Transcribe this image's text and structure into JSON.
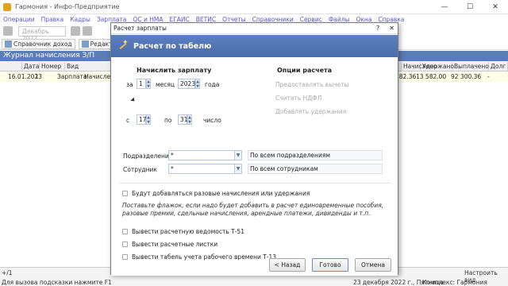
{
  "window": {
    "title": "Гармония - Инфо-Предприятие"
  },
  "menu": [
    "Операции",
    "Правка",
    "Кадры",
    "Зарплата",
    "ОС и НМА",
    "ЕГАИС",
    "ВЕТИС",
    "Отчеты",
    "Справочники",
    "Сервис",
    "Файлы",
    "Окна",
    "Справка"
  ],
  "toolbar": {
    "period": "Декабрь 2022",
    "btn_directory": "Справочник доход",
    "btn_edit": "Редактиров"
  },
  "journal": {
    "title": "Журнал начисления З/П",
    "columns": [
      "Дата",
      "Номер",
      "Вид",
      "",
      "Начислено",
      "Удержано",
      "Выплачено",
      "Долг"
    ],
    "row": {
      "date": "16.01.2023",
      "number": "1",
      "kind": "Зарплата",
      "kind2": "Начисле",
      "accrued": "582.36",
      "withheld": "13 582.00",
      "paid": "92 300.36",
      "debt": "-"
    },
    "footer_count": "+/1"
  },
  "status": {
    "hint": "Для вызова подсказки нажмите F1",
    "date": "23 декабря 2022 г., Пятница",
    "company": "Комплекс: Гармония",
    "settings": "Настроить вид"
  },
  "dialog": {
    "window_title": "Расчет зарплаты",
    "help": "?",
    "close": "✕",
    "header": "Расчет по табелю",
    "section_calc": "Начислить зарплату",
    "section_options": "Опции расчета",
    "label_for": "за",
    "day_value": "1",
    "label_month": "месяц",
    "year_value": "2023",
    "label_year": "года",
    "label_from": "с",
    "from_value": "17",
    "label_to": "по",
    "to_value": "31",
    "label_day": "число",
    "opt_deductions": "Предоставлять вычеты",
    "opt_ndfl": "Считать НДФЛ",
    "opt_withholding": "Добавлять удержания",
    "label_department": "Подразделение",
    "department_value": "*",
    "department_info": "По всем подразделениям",
    "label_employee": "Сотрудник",
    "employee_value": "*",
    "employee_info": "По всем сотрудникам",
    "check_onetime": "Будут добавляться разовые начисления или удержания",
    "hint_text_1": "Поставьте флажок, если надо будет добавить в расчет единовременные пособия,",
    "hint_text_2": "разовые премии, сдельные начисления, арендные платежи, дивиденды и т.п.",
    "check_t51": "Вывести расчетную ведомость Т-51",
    "check_slips": "Вывести расчетные листки",
    "check_t13": "Вывести табель учета рабочего времени Т-13",
    "btn_back": "< Назад",
    "btn_done": "Готово",
    "btn_cancel": "Отмена"
  }
}
